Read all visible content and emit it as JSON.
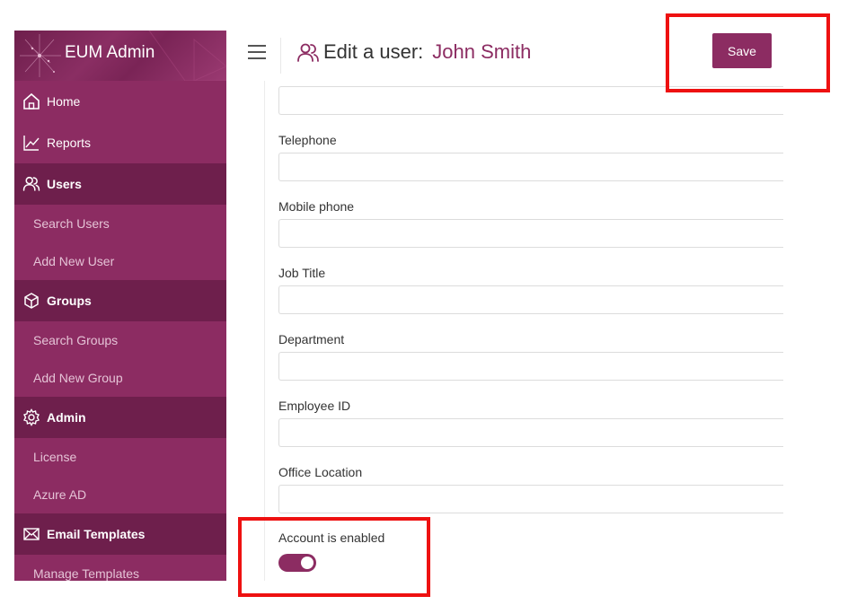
{
  "app": {
    "title": "EUM Admin"
  },
  "sidebar": {
    "items": [
      {
        "label": "Home",
        "type": "plain",
        "icon": "home-icon"
      },
      {
        "label": "Reports",
        "type": "plain",
        "icon": "chart-icon"
      },
      {
        "label": "Users",
        "type": "section",
        "icon": "users-icon"
      },
      {
        "label": "Search Users",
        "type": "sub"
      },
      {
        "label": "Add New User",
        "type": "sub"
      },
      {
        "label": "Groups",
        "type": "section",
        "icon": "cube-icon"
      },
      {
        "label": "Search Groups",
        "type": "sub"
      },
      {
        "label": "Add New Group",
        "type": "sub"
      },
      {
        "label": "Admin",
        "type": "section",
        "icon": "gear-icon"
      },
      {
        "label": "License",
        "type": "sub"
      },
      {
        "label": "Azure AD",
        "type": "sub"
      },
      {
        "label": "Email Templates",
        "type": "section",
        "icon": "envelope-icon"
      },
      {
        "label": "Manage Templates",
        "type": "sub"
      }
    ]
  },
  "header": {
    "title": "Edit a user:",
    "user_name": "John Smith",
    "save_label": "Save"
  },
  "form": {
    "fields": [
      {
        "label": "Telephone",
        "value": ""
      },
      {
        "label": "Mobile phone",
        "value": ""
      },
      {
        "label": "Job Title",
        "value": ""
      },
      {
        "label": "Department",
        "value": ""
      },
      {
        "label": "Employee ID",
        "value": ""
      },
      {
        "label": "Office Location",
        "value": ""
      }
    ],
    "top_field_value": "",
    "account_enabled_label": "Account is enabled",
    "account_enabled": true
  },
  "colors": {
    "accent": "#8c2c62",
    "sidebar_section": "#6e1f4c",
    "highlight": "#ee1111"
  }
}
